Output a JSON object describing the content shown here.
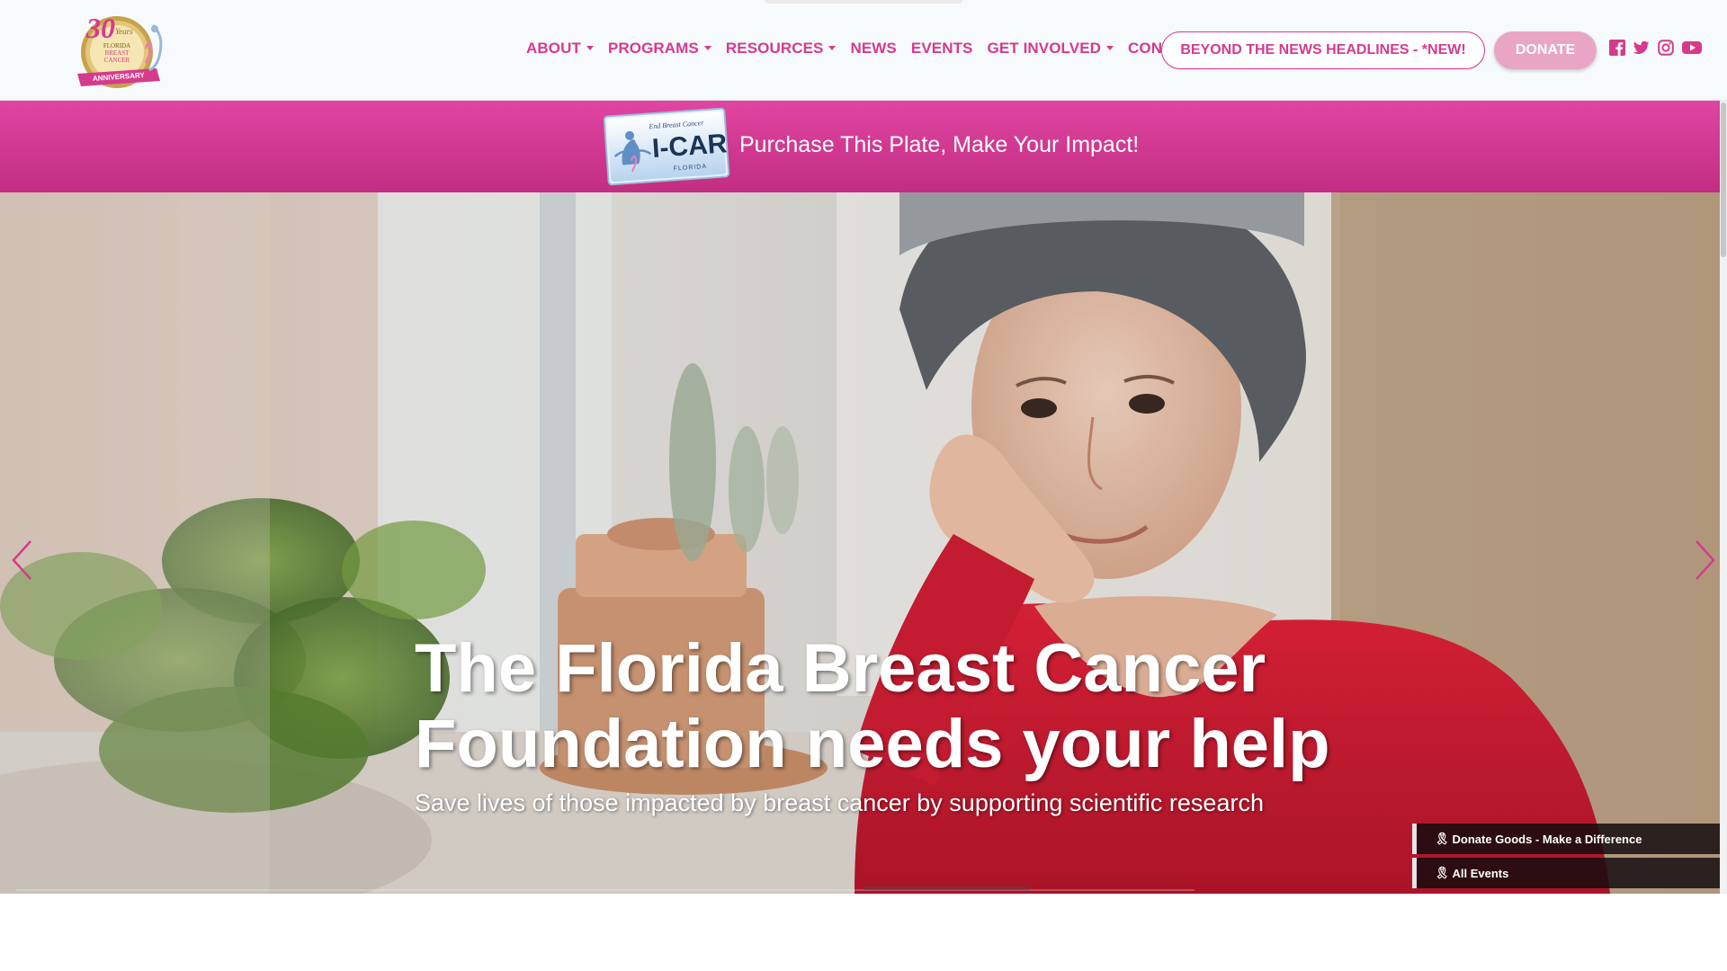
{
  "header": {
    "logo_text": "30 Years Florida Breast Cancer Foundation Anniversary",
    "nav": [
      {
        "label": "ABOUT",
        "dropdown": true
      },
      {
        "label": "PROGRAMS",
        "dropdown": true
      },
      {
        "label": "RESOURCES",
        "dropdown": true
      },
      {
        "label": "NEWS",
        "dropdown": false
      },
      {
        "label": "EVENTS",
        "dropdown": false
      },
      {
        "label": "GET INVOLVED",
        "dropdown": true
      },
      {
        "label": "CONTACT",
        "dropdown": false
      }
    ],
    "headlines_button": "BEYOND THE NEWS HEADLINES - *NEW!",
    "donate_button": "DONATE",
    "socials": [
      "facebook-icon",
      "twitter-icon",
      "instagram-icon",
      "youtube-icon"
    ]
  },
  "promo": {
    "plate_text": "I-CARE",
    "plate_top_text": "End Breast Cancer",
    "plate_bottom_text": "FLORIDA",
    "text": "Purchase This Plate, Make Your Impact!"
  },
  "hero": {
    "title_line1": "The Florida Breast Cancer",
    "title_line2": "Foundation needs your help",
    "subtitle": "Save lives of those impacted by breast cancer by supporting scientific research",
    "quick_links": [
      {
        "icon": "ribbon-icon",
        "label": "Donate Goods - Make a Difference"
      },
      {
        "icon": "ribbon-icon",
        "label": "All Events"
      }
    ]
  },
  "colors": {
    "brand_pink": "#d63a8c",
    "banner_top": "#e045a2",
    "banner_bottom": "#c22d81",
    "donate_bg": "#e9a6c4"
  }
}
